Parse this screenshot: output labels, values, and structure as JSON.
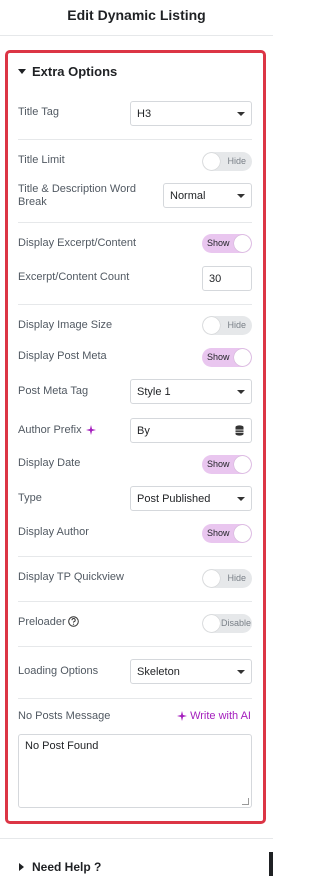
{
  "header": {
    "title": "Edit Dynamic Listing"
  },
  "section": {
    "title": "Extra Options"
  },
  "fields": {
    "title_tag": {
      "label": "Title Tag",
      "value": "H3"
    },
    "title_limit": {
      "label": "Title Limit",
      "toggle": "Hide"
    },
    "word_break": {
      "label": "Title & Description Word Break",
      "value": "Normal"
    },
    "display_excerpt": {
      "label": "Display Excerpt/Content",
      "toggle": "Show"
    },
    "excerpt_count": {
      "label": "Excerpt/Content Count",
      "value": "30"
    },
    "display_image_size": {
      "label": "Display Image Size",
      "toggle": "Hide"
    },
    "display_post_meta": {
      "label": "Display Post Meta",
      "toggle": "Show"
    },
    "post_meta_tag": {
      "label": "Post Meta Tag",
      "value": "Style 1"
    },
    "author_prefix": {
      "label": "Author Prefix",
      "value": "By"
    },
    "display_date": {
      "label": "Display Date",
      "toggle": "Show"
    },
    "type": {
      "label": "Type",
      "value": "Post Published"
    },
    "display_author": {
      "label": "Display Author",
      "toggle": "Show"
    },
    "display_quickview": {
      "label": "Display TP Quickview",
      "toggle": "Hide"
    },
    "preloader": {
      "label": "Preloader",
      "toggle": "Disable"
    },
    "loading_options": {
      "label": "Loading Options",
      "value": "Skeleton"
    },
    "no_posts_message": {
      "label": "No Posts Message",
      "ai_link": "Write with AI",
      "value": "No Post Found"
    }
  },
  "help": {
    "title": "Need Help ?"
  },
  "colors": {
    "accent": "#a41ebd",
    "toggle_on": "#e9c6ef",
    "border_highlight": "#dc3545"
  },
  "icons": [
    "caret-down-icon",
    "sparkle-ai-icon",
    "database-icon",
    "help-circle-icon",
    "caret-right-icon",
    "resize-handle-icon"
  ]
}
